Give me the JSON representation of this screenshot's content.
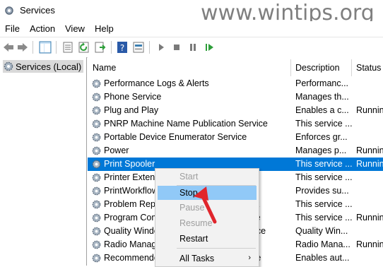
{
  "window": {
    "title": "Services",
    "watermark": "www.wintips.org"
  },
  "menu": [
    "File",
    "Action",
    "View",
    "Help"
  ],
  "toolbar": {
    "icons": [
      "back-arrow-icon",
      "forward-arrow-icon",
      "console-tree-icon",
      "properties-icon",
      "refresh-icon",
      "export-list-icon",
      "help-icon",
      "view-icon",
      "start-service-icon",
      "stop-service-icon",
      "pause-service-icon",
      "restart-service-icon"
    ]
  },
  "tree": {
    "root_label": "Services (Local)"
  },
  "columns": {
    "name": "Name",
    "description": "Description",
    "status": "Status"
  },
  "services": [
    {
      "name": "Performance Logs & Alerts",
      "description": "Performanc...",
      "status": ""
    },
    {
      "name": "Phone Service",
      "description": "Manages th...",
      "status": ""
    },
    {
      "name": "Plug and Play",
      "description": "Enables a c...",
      "status": "Running"
    },
    {
      "name": "PNRP Machine Name Publication Service",
      "description": "This service ...",
      "status": ""
    },
    {
      "name": "Portable Device Enumerator Service",
      "description": "Enforces gr...",
      "status": ""
    },
    {
      "name": "Power",
      "description": "Manages p...",
      "status": "Running"
    },
    {
      "name": "Print Spooler",
      "description": "This service ...",
      "status": "Running"
    },
    {
      "name": "Printer Extensions and Notifications",
      "description": "This service ...",
      "status": ""
    },
    {
      "name": "PrintWorkflow",
      "description": "Provides su...",
      "status": ""
    },
    {
      "name": "Problem Reports Control Panel Support",
      "description": "This service ...",
      "status": ""
    },
    {
      "name": "Program Compatibility Assistant Service",
      "description": "This service ...",
      "status": "Running"
    },
    {
      "name": "Quality Windows Audio Video Experience",
      "description": "Quality Win...",
      "status": ""
    },
    {
      "name": "Radio Management Service",
      "description": "Radio Mana...",
      "status": "Running"
    },
    {
      "name": "Recommended Troubleshooting Service",
      "description": "Enables aut...",
      "status": ""
    }
  ],
  "context_menu": {
    "items": [
      {
        "label": "Start",
        "enabled": false
      },
      {
        "label": "Stop",
        "enabled": true,
        "highlighted": true
      },
      {
        "label": "Pause",
        "enabled": false
      },
      {
        "label": "Resume",
        "enabled": false
      },
      {
        "label": "Restart",
        "enabled": true
      },
      {
        "label": "All Tasks",
        "enabled": true,
        "submenu": true
      }
    ]
  },
  "colors": {
    "selection": "#0078d7",
    "menu_highlight": "#91c9f7",
    "pointer": "#e0262c",
    "watermark": "#7f7f7f"
  }
}
